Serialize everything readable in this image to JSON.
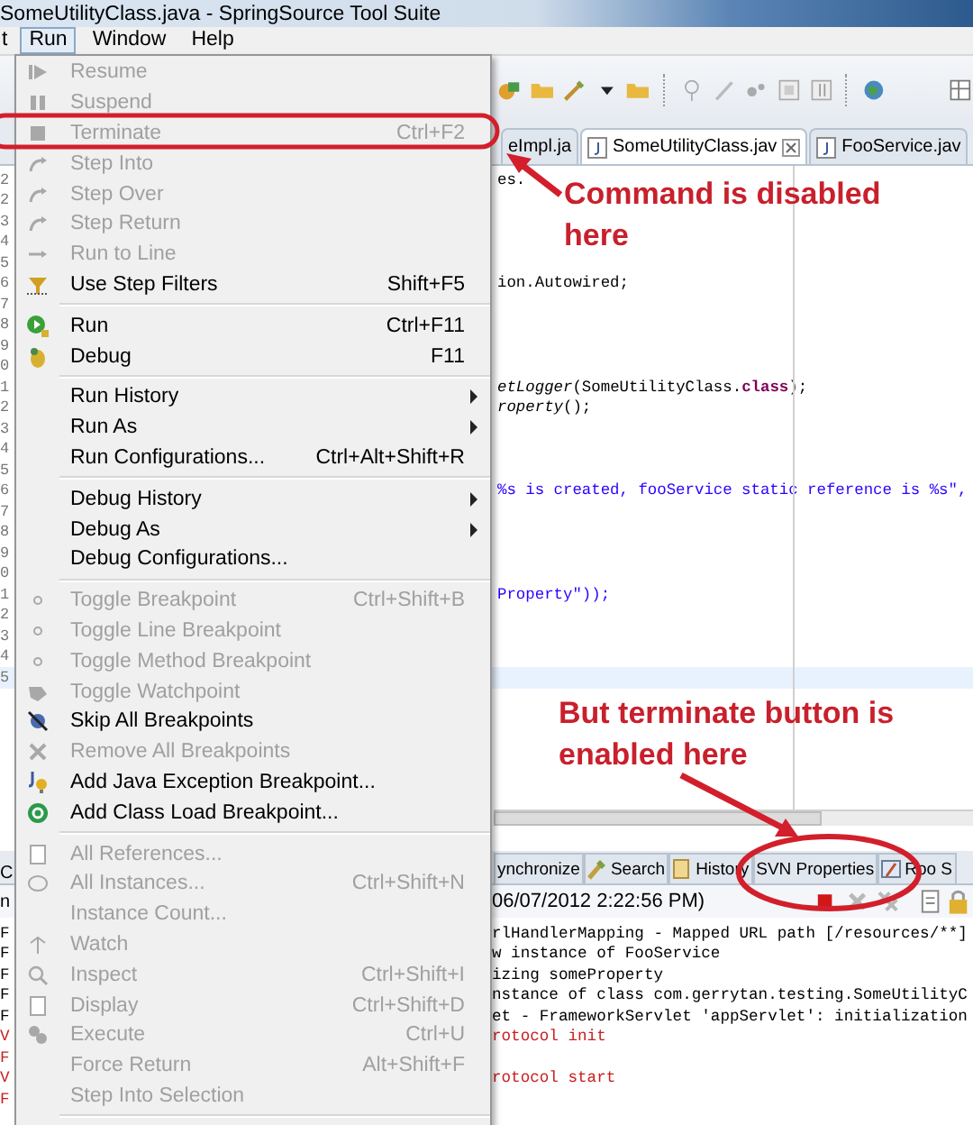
{
  "window": {
    "title": "SomeUtilityClass.java - SpringSource Tool Suite"
  },
  "menubar": [
    {
      "label": "t",
      "selected": false
    },
    {
      "label": "Run",
      "selected": true
    },
    {
      "label": "Window",
      "selected": false
    },
    {
      "label": "Help",
      "selected": false
    }
  ],
  "run_menu": [
    {
      "kind": "item",
      "label": "Resume",
      "disabled": true,
      "submenu": false
    },
    {
      "kind": "item",
      "label": "Suspend",
      "disabled": true,
      "submenu": false
    },
    {
      "kind": "item",
      "label": "Terminate",
      "shortcut": "Ctrl+F2",
      "disabled": true,
      "submenu": false
    },
    {
      "kind": "item",
      "label": "Step Into",
      "disabled": true,
      "submenu": false
    },
    {
      "kind": "item",
      "label": "Step Over",
      "disabled": true,
      "submenu": false
    },
    {
      "kind": "item",
      "label": "Step Return",
      "disabled": true,
      "submenu": false
    },
    {
      "kind": "item",
      "label": "Run to Line",
      "disabled": true,
      "submenu": false
    },
    {
      "kind": "item",
      "label": "Use Step Filters",
      "shortcut": "Shift+F5",
      "disabled": false,
      "submenu": false
    },
    {
      "kind": "separator"
    },
    {
      "kind": "item",
      "label": "Run",
      "shortcut": "Ctrl+F11",
      "disabled": false,
      "submenu": false
    },
    {
      "kind": "item",
      "label": "Debug",
      "shortcut": "F11",
      "disabled": false,
      "submenu": false
    },
    {
      "kind": "separator"
    },
    {
      "kind": "item",
      "label": "Run History",
      "disabled": false,
      "submenu": true
    },
    {
      "kind": "item",
      "label": "Run As",
      "disabled": false,
      "submenu": true
    },
    {
      "kind": "item",
      "label": "Run Configurations...",
      "shortcut": "Ctrl+Alt+Shift+R",
      "disabled": false,
      "submenu": false
    },
    {
      "kind": "separator"
    },
    {
      "kind": "item",
      "label": "Debug History",
      "disabled": false,
      "submenu": true
    },
    {
      "kind": "item",
      "label": "Debug As",
      "disabled": false,
      "submenu": true
    },
    {
      "kind": "item",
      "label": "Debug Configurations...",
      "disabled": false,
      "submenu": false
    },
    {
      "kind": "separator"
    },
    {
      "kind": "item",
      "label": "Toggle Breakpoint",
      "shortcut": "Ctrl+Shift+B",
      "disabled": true,
      "submenu": false
    },
    {
      "kind": "item",
      "label": "Toggle Line Breakpoint",
      "disabled": true,
      "submenu": false
    },
    {
      "kind": "item",
      "label": "Toggle Method Breakpoint",
      "disabled": true,
      "submenu": false
    },
    {
      "kind": "item",
      "label": "Toggle Watchpoint",
      "disabled": true,
      "submenu": false
    },
    {
      "kind": "item",
      "label": "Skip All Breakpoints",
      "disabled": false,
      "submenu": false
    },
    {
      "kind": "item",
      "label": "Remove All Breakpoints",
      "disabled": true,
      "submenu": false
    },
    {
      "kind": "item",
      "label": "Add Java Exception Breakpoint...",
      "disabled": false,
      "submenu": false
    },
    {
      "kind": "item",
      "label": "Add Class Load Breakpoint...",
      "disabled": false,
      "submenu": false
    },
    {
      "kind": "separator"
    },
    {
      "kind": "item",
      "label": "All References...",
      "disabled": true,
      "submenu": false
    },
    {
      "kind": "item",
      "label": "All Instances...",
      "shortcut": "Ctrl+Shift+N",
      "disabled": true,
      "submenu": false
    },
    {
      "kind": "item",
      "label": "Instance Count...",
      "disabled": true,
      "submenu": false
    },
    {
      "kind": "item",
      "label": "Watch",
      "disabled": true,
      "submenu": false
    },
    {
      "kind": "item",
      "label": "Inspect",
      "shortcut": "Ctrl+Shift+I",
      "disabled": true,
      "submenu": false
    },
    {
      "kind": "item",
      "label": "Display",
      "shortcut": "Ctrl+Shift+D",
      "disabled": true,
      "submenu": false
    },
    {
      "kind": "item",
      "label": "Execute",
      "shortcut": "Ctrl+U",
      "disabled": true,
      "submenu": false
    },
    {
      "kind": "item",
      "label": "Force Return",
      "shortcut": "Alt+Shift+F",
      "disabled": true,
      "submenu": false
    },
    {
      "kind": "item",
      "label": "Step Into Selection",
      "disabled": true,
      "submenu": false
    },
    {
      "kind": "separator"
    }
  ],
  "editor_tabs": [
    {
      "label": "eImpl.ja",
      "selected": false,
      "closable": false
    },
    {
      "label": "SomeUtilityClass.jav",
      "selected": true,
      "closable": true
    },
    {
      "label": "FooService.jav",
      "selected": false,
      "closable": false
    }
  ],
  "editor_lines": [
    {
      "number": "2",
      "code": "es.",
      "kind": "plain",
      "current": false
    },
    {
      "number": "2",
      "current": false
    },
    {
      "number": "3",
      "current": false
    },
    {
      "number": "4",
      "current": false
    },
    {
      "number": "5",
      "current": false
    },
    {
      "number": "6",
      "code": "ion.Autowired;",
      "kind": "plain",
      "current": false
    },
    {
      "number": "7",
      "current": false
    },
    {
      "number": "8",
      "current": false
    },
    {
      "number": "9",
      "current": false
    },
    {
      "number": "0",
      "current": false
    },
    {
      "number": "1",
      "code": "*etLogger*(SomeUtilityClass.**class**);",
      "kind": "plain",
      "current": false
    },
    {
      "number": "2",
      "code": "*roperty*();",
      "kind": "plain",
      "current": false
    },
    {
      "number": "3",
      "current": false
    },
    {
      "number": "4",
      "current": false
    },
    {
      "number": "5",
      "current": false
    },
    {
      "number": "6",
      "code": "%s is created, fooService static reference is %s\",",
      "kind": "string",
      "current": false
    },
    {
      "number": "7",
      "current": false
    },
    {
      "number": "8",
      "current": false
    },
    {
      "number": "9",
      "current": false
    },
    {
      "number": "0",
      "current": false
    },
    {
      "number": "1",
      "code": "Property\"));",
      "kind": "string",
      "current": false
    },
    {
      "number": "2",
      "current": false
    },
    {
      "number": "3",
      "current": false
    },
    {
      "number": "4",
      "current": false
    },
    {
      "number": "5",
      "current": true
    }
  ],
  "console_view": {
    "tab_fragment": "C",
    "title_fragment": "n"
  },
  "bottom_tabs": [
    {
      "label": "ynchronize",
      "selected": false
    },
    {
      "label": "Search",
      "selected": false
    },
    {
      "label": "History",
      "selected": false
    },
    {
      "label": "SVN Properties",
      "selected": false
    },
    {
      "label": "Roo S",
      "selected": false
    }
  ],
  "console": {
    "title": "06/07/2012 2:22:56 PM)",
    "buttons": [
      {
        "disabled": false
      },
      {
        "disabled": true
      },
      {
        "disabled": true
      }
    ],
    "lines": [
      {
        "prefix": "F",
        "text": "rlHandlerMapping - Mapped URL path [/resources/**]",
        "kind": "info"
      },
      {
        "prefix": "F",
        "text": "w instance of FooService",
        "kind": "info"
      },
      {
        "prefix": "F",
        "text": "izing someProperty",
        "kind": "info"
      },
      {
        "prefix": "F",
        "text": "nstance of class com.gerrytan.testing.SomeUtilityC",
        "kind": "info"
      },
      {
        "prefix": "F",
        "text": "et - FrameworkServlet 'appServlet': initialization",
        "kind": "info"
      },
      {
        "prefix": "V",
        "text": "rotocol init",
        "kind": "error"
      },
      {
        "prefix": "F",
        "kind": "error"
      },
      {
        "prefix": "V",
        "text": "rotocol start",
        "kind": "error"
      },
      {
        "prefix": "F",
        "kind": "error"
      }
    ]
  },
  "annotations": [
    {
      "text": "Command is disabled here"
    },
    {
      "text": "But terminate button is enabled here"
    }
  ]
}
